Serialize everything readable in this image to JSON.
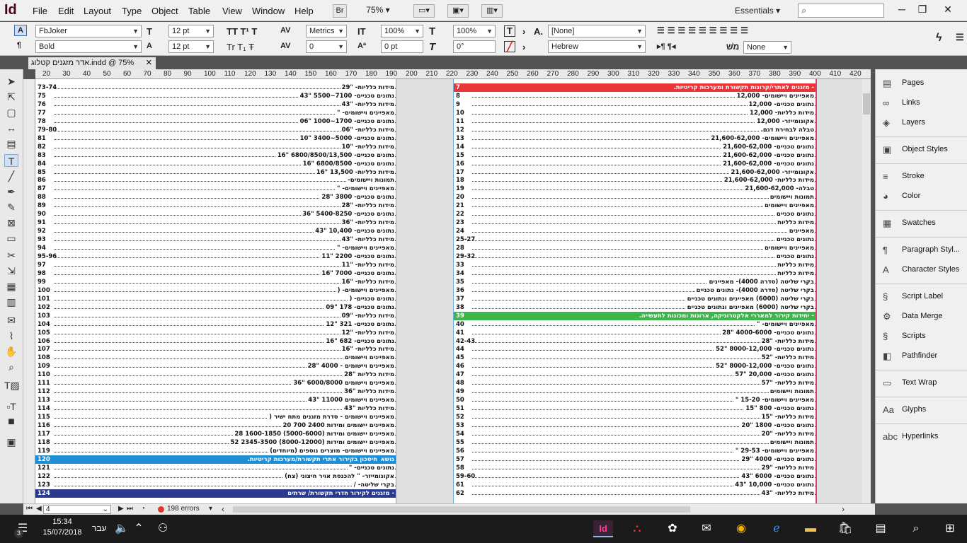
{
  "app": {
    "logo": "Id",
    "menus": [
      "File",
      "Edit",
      "Layout",
      "Type",
      "Object",
      "Table",
      "View",
      "Window",
      "Help"
    ],
    "bridge_label": "Br",
    "zoom": "75%",
    "workspace": "Essentials",
    "search_placeholder": ""
  },
  "control": {
    "font_family": "FbJoker",
    "font_style": "Bold",
    "font_size": "12 pt",
    "leading": "12 pt",
    "kerning": "Metrics",
    "tracking": "0",
    "vscale": "100%",
    "hscale": "100%",
    "baseline": "0 pt",
    "skew": "0°",
    "char_style": "[None]",
    "language": "Hebrew",
    "none_label": "None"
  },
  "document": {
    "tab_title": "אדר מזגנים קטלוג.indd @ 75%"
  },
  "ruler": {
    "ticks": [
      "20",
      "30",
      "40",
      "50",
      "60",
      "70",
      "80",
      "90",
      "100",
      "110",
      "120",
      "130",
      "140",
      "150",
      "160",
      "170",
      "180",
      "190",
      "200",
      "210",
      "220",
      "230",
      "240",
      "250",
      "260",
      "270",
      "280",
      "290",
      "300",
      "310",
      "320",
      "330",
      "340",
      "350",
      "360",
      "370",
      "380",
      "390",
      "400",
      "410",
      "420"
    ]
  },
  "left_page": {
    "rows": [
      {
        "n": "73-74",
        "t": "מידות כלליות- \"29"
      },
      {
        "n": "75",
        "t": "נתונים טכניים- 7100~5500 \"43"
      },
      {
        "n": "76",
        "t": "מידות כלליות- \"43"
      },
      {
        "n": "77",
        "t": "מאפיינים ויישומים- \""
      },
      {
        "n": "78",
        "t": "נתונים טכניים- 1700~1000 \"06"
      },
      {
        "n": "79-80",
        "t": "מידות כלליות- \"06"
      },
      {
        "n": "81",
        "t": "נתונים טכניים- 5000~3400 \"10"
      },
      {
        "n": "82",
        "t": "מידות כלליות- \"10"
      },
      {
        "n": "83",
        "t": "נתונים טכניים- 6800/8500/13,500 \"16"
      },
      {
        "n": "84",
        "t": "נתונים טכניים- 6800/8500 \"16"
      },
      {
        "n": "85",
        "t": "מידות כלליות- 13,500 \"16"
      },
      {
        "n": "86",
        "t": "תמונות ויישומים-"
      },
      {
        "n": "87",
        "t": "מאפיינים ויישומים- \""
      },
      {
        "n": "88",
        "t": "נתונים טכניים- 3800 \"28"
      },
      {
        "n": "89",
        "t": "מידות כלליות- \"28"
      },
      {
        "n": "90",
        "t": "נתונים טכניים- 5400-8250 \"36"
      },
      {
        "n": "91",
        "t": "מידות כלליות- \"36"
      },
      {
        "n": "92",
        "t": "נתונים טכניים- 10,400 \"43"
      },
      {
        "n": "93",
        "t": "מידות כלליות- \"43"
      },
      {
        "n": "94",
        "t": "מאפיינים ויישומים- \""
      },
      {
        "n": "95-96",
        "t": "נתונים טכניים- 2200 \"11"
      },
      {
        "n": "97",
        "t": "מידות כלליות- \"11"
      },
      {
        "n": "98",
        "t": "נתונים טכניים- 7000 \"16"
      },
      {
        "n": "99",
        "t": "מידות כלליות- \"16"
      },
      {
        "n": "100",
        "t": "מאפיינים ויישומים- ("
      },
      {
        "n": "101",
        "t": "נתונים טכניים- ("
      },
      {
        "n": "102",
        "t": "נתונים טכניים- 178 \"09"
      },
      {
        "n": "103",
        "t": "מידות כלליות- \"09"
      },
      {
        "n": "104",
        "t": "נתונים טכניים- 321 \"12"
      },
      {
        "n": "105",
        "t": "מידות כלליות- \"12"
      },
      {
        "n": "106",
        "t": "נתונים טכניים- 682 \"16"
      },
      {
        "n": "107",
        "t": "מידות כלליות- \"16"
      },
      {
        "n": "108",
        "t": "מאפיינים ויישומים"
      },
      {
        "n": "109",
        "t": "מאפיינים ויישומים - 4000 \"28"
      },
      {
        "n": "110",
        "t": "מידות כלליות \"28"
      },
      {
        "n": "111",
        "t": "מאפיינים ויישומים 6000/8000 \"36"
      },
      {
        "n": "112",
        "t": "מידות כלליות \"36"
      },
      {
        "n": "113",
        "t": "מאפיינים ויישומים 11000 \"43"
      },
      {
        "n": "114",
        "t": "מידות כלליות \"43"
      },
      {
        "n": "115",
        "t": "מאפיינים ויישומים - סדרת מזגנים מתח ישיר ("
      },
      {
        "n": "116",
        "t": "מאפיינים יישומים ומידות 2400 700 20"
      },
      {
        "n": "117",
        "t": "מאפיינים יישומים ומידות (5000-6000) 1600-1850 28"
      },
      {
        "n": "118",
        "t": "מאפיינים יישומים ומידות (8000-12000) 2345-3500 52"
      },
      {
        "n": "119",
        "t": "מאפיינים ויישומים- מוצרים נוספים (מיוחדים)"
      },
      {
        "n": "120",
        "t": "חיסכון בקירור אתרי תקשורת/מערכות קריטיות.",
        "band": "blue",
        "label": "נושא"
      },
      {
        "n": "121",
        "t": "נתונים טכניים- \""
      },
      {
        "n": "122",
        "t": "אקונומייזר- \" להכנסת אויר חיצוני (צח)"
      },
      {
        "n": "123",
        "t": "בקרי שליטה- /"
      },
      {
        "n": "124",
        "t": "- מזגנים לקירור חדרי תקשורת/ שרתים",
        "band": "navy"
      }
    ]
  },
  "right_page": {
    "rows": [
      {
        "n": "7",
        "t": "- מזגנים לאתרי/קרונות תקשורת ומערכות קריטיות.",
        "band": "red"
      },
      {
        "n": "8",
        "t": "מאפיינים ויישומים- 12,000"
      },
      {
        "n": "9",
        "t": "נתונים טכניים- 12,000"
      },
      {
        "n": "10",
        "t": "מידות כלליות- 12,000"
      },
      {
        "n": "11",
        "t": "אקונומייזר- 12,000"
      },
      {
        "n": "12",
        "t": "טבלה לבחירת דגם."
      },
      {
        "n": "13",
        "t": "מאפיינים ויישומים- 21,600-62,000"
      },
      {
        "n": "14",
        "t": "נתונים טכניים- 21,600-62,000"
      },
      {
        "n": "15",
        "t": "נתונים טכניים- 21,600-62,000"
      },
      {
        "n": "16",
        "t": "נתונים טכניים- 21,600-62,000"
      },
      {
        "n": "17",
        "t": "אקונומייזר- 21,600-62,000"
      },
      {
        "n": "18",
        "t": "מידות כלליות- 21,600-62,000"
      },
      {
        "n": "19",
        "t": "טבלה- 21,600-62,000"
      },
      {
        "n": "20",
        "t": "תמונות ויישומים"
      },
      {
        "n": "21",
        "t": "מאפיינים ויישומים"
      },
      {
        "n": "22",
        "t": "נתונים טכניים"
      },
      {
        "n": "23",
        "t": "מידות כלליות"
      },
      {
        "n": "24",
        "t": "מאפיינים"
      },
      {
        "n": "25-27",
        "t": "נתונים טכניים"
      },
      {
        "n": "28",
        "t": "מאפיינים ויישומים"
      },
      {
        "n": "29-32",
        "t": "נתונים טכניים"
      },
      {
        "n": "33",
        "t": "מידות כלליות"
      },
      {
        "n": "34",
        "t": "מידות כלליות"
      },
      {
        "n": "35",
        "t": "בקרי שליטה (סדרה 4000)- מאפיינים"
      },
      {
        "n": "36",
        "t": "בקרי שליטה (סדרה 4000)- נתונים טכניים"
      },
      {
        "n": "37",
        "t": "בקרי שליטה (6000) מאפיינים ונתונים טכניים"
      },
      {
        "n": "38",
        "t": "בקרי שליטה (6000) מאפיינים ונתונים טכניים"
      },
      {
        "n": "39",
        "t": "- יחידות קירור למאררי אלקטרוניקה, ארונות ומכונות לתעשייה.",
        "band": "green"
      },
      {
        "n": "40",
        "t": "מאפיינים ויישומים- \""
      },
      {
        "n": "41",
        "t": "נתונים טכניים- 4000-6000 \"28"
      },
      {
        "n": "42-43",
        "t": "מידות כלליות- \"28"
      },
      {
        "n": "44",
        "t": "נתונים טכניים- 8000-12,000 \"52"
      },
      {
        "n": "45",
        "t": "מידות כלליות- \"52"
      },
      {
        "n": "46",
        "t": "נתונים טכניים- 8000-12,000 \"52"
      },
      {
        "n": "47",
        "t": "נתונים טכניים- 20,000 \"57"
      },
      {
        "n": "48",
        "t": "מידות כלליות- \"57"
      },
      {
        "n": "49",
        "t": "תמונות ויישומים"
      },
      {
        "n": "50",
        "t": "מאפיינים ויישומים- 15-20 \""
      },
      {
        "n": "51",
        "t": "נתונים טכניים- 800 \"15"
      },
      {
        "n": "52",
        "t": "מידות כלליות- \"15"
      },
      {
        "n": "53",
        "t": "נתונים טכניים- 1800 \"20"
      },
      {
        "n": "54",
        "t": "מידות כלליות- \"20"
      },
      {
        "n": "55",
        "t": "תמונות ויישומים"
      },
      {
        "n": "56",
        "t": "מאפיינים ויישומים- 29-53 \""
      },
      {
        "n": "57",
        "t": "נתונים טכניים- 4000 \"29"
      },
      {
        "n": "58",
        "t": "מידות כלליות- \"29"
      },
      {
        "n": "59-60",
        "t": "נתונים טכניים- 6000 \"43"
      },
      {
        "n": "61",
        "t": "נתונים טכניים- 10,000 \"43"
      },
      {
        "n": "62",
        "t": "מידות כלליות- \"43"
      }
    ]
  },
  "panels": [
    {
      "label": "Pages",
      "icon": "pages-icon",
      "glyph": "▤"
    },
    {
      "label": "Links",
      "icon": "links-icon",
      "glyph": "∞"
    },
    {
      "label": "Layers",
      "icon": "layers-icon",
      "glyph": "◈"
    },
    {
      "label": "Object Styles",
      "icon": "object-styles-icon",
      "glyph": "▣"
    },
    {
      "label": "Stroke",
      "icon": "stroke-icon",
      "glyph": "≡"
    },
    {
      "label": "Color",
      "icon": "color-icon",
      "glyph": "◕"
    },
    {
      "label": "Swatches",
      "icon": "swatches-icon",
      "glyph": "▦"
    },
    {
      "label": "Paragraph Styl...",
      "icon": "paragraph-styles-icon",
      "glyph": "¶"
    },
    {
      "label": "Character Styles",
      "icon": "character-styles-icon",
      "glyph": "A"
    },
    {
      "label": "Script Label",
      "icon": "script-label-icon",
      "glyph": "§"
    },
    {
      "label": "Data Merge",
      "icon": "data-merge-icon",
      "glyph": "⚙"
    },
    {
      "label": "Scripts",
      "icon": "scripts-icon",
      "glyph": "§"
    },
    {
      "label": "Pathfinder",
      "icon": "pathfinder-icon",
      "glyph": "◧"
    },
    {
      "label": "Text Wrap",
      "icon": "text-wrap-icon",
      "glyph": "▭"
    },
    {
      "label": "Glyphs",
      "icon": "glyphs-icon",
      "glyph": "Aa"
    },
    {
      "label": "Hyperlinks",
      "icon": "hyperlinks-icon",
      "glyph": "abc"
    }
  ],
  "status": {
    "page": "4",
    "errors": "198 errors"
  },
  "taskbar": {
    "time": "15:34",
    "date": "15/07/2018",
    "lang": "עבר",
    "notif_count": "3"
  },
  "colors": {
    "red_band": "#e8353a",
    "green_band": "#3cb54a",
    "blue_band": "#1e8fd6",
    "navy_band": "#2b3a8c",
    "highlight": "#f5b8a4"
  }
}
